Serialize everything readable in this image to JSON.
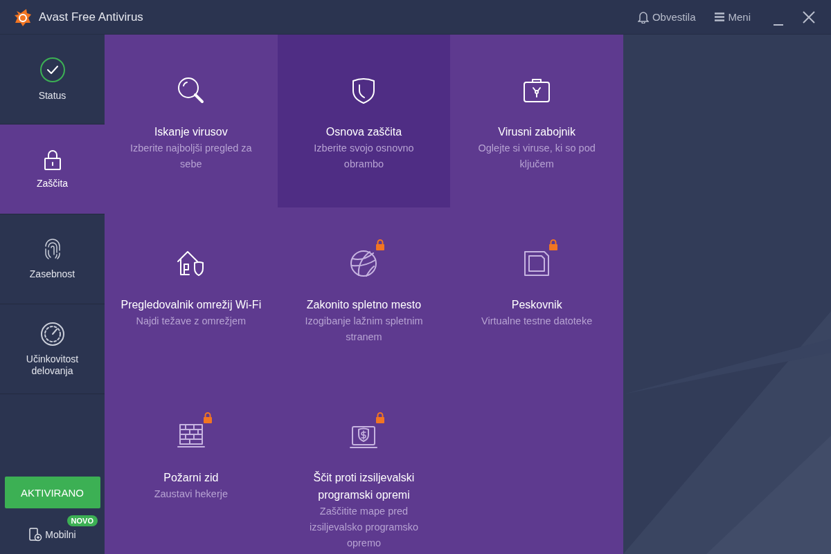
{
  "window": {
    "title": "Avast Free Antivirus",
    "notifications": "Obvestila",
    "menu": "Meni"
  },
  "sidebar": {
    "items": [
      {
        "label": "Status",
        "kind": "status",
        "selected": false
      },
      {
        "label": "Zaščita",
        "kind": "lock",
        "selected": true
      },
      {
        "label": "Zasebnost",
        "kind": "fingerprint",
        "selected": false
      },
      {
        "label": "Učinkovitost delovanja",
        "kind": "gauge",
        "selected": false
      }
    ],
    "activate_button": "AKTIVIRANO",
    "badge": "NOVO",
    "mobile": "Mobilni"
  },
  "tiles": [
    {
      "kind": "search",
      "title": "Iskanje virusov",
      "description": "Izberite najboljši pregled za sebe",
      "locked": false,
      "selected": false
    },
    {
      "kind": "shield",
      "title": "Osnova zaščita",
      "description": "Izberite svojo osnovno obrambo",
      "locked": false,
      "selected": true
    },
    {
      "kind": "chest",
      "title": "Virusni zabojnik",
      "description": "Oglejte si viruse, ki so pod ključem",
      "locked": false,
      "selected": false
    },
    {
      "kind": "house",
      "title": "Pregledovalnik omrežij Wi-Fi",
      "description": "Najdi težave z omrežjem",
      "locked": false,
      "selected": false
    },
    {
      "kind": "globe",
      "title": "Zakonito spletno mesto",
      "description": "Izogibanje lažnim spletnim stranem",
      "locked": true,
      "selected": false
    },
    {
      "kind": "sandbox",
      "title": "Peskovnik",
      "description": "Virtualne testne datoteke",
      "locked": true,
      "selected": false
    },
    {
      "kind": "firewall",
      "title": "Požarni zid",
      "description": "Zaustavi hekerje",
      "locked": true,
      "selected": false
    },
    {
      "kind": "ransomware",
      "title": "Ščit proti izsiljevalski programski opremi",
      "description": "Zaščitite mape pred izsiljevalsko programsko opremo",
      "locked": true,
      "selected": false
    }
  ]
}
